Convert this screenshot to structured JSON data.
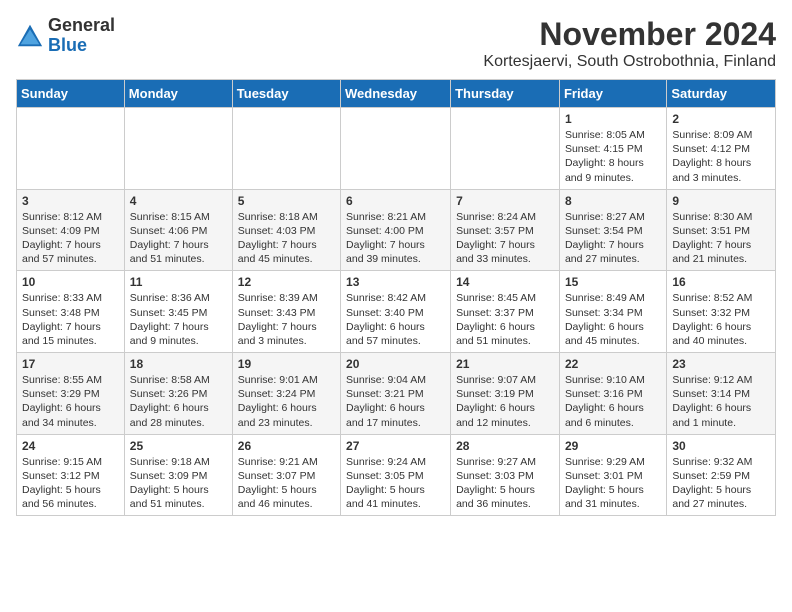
{
  "header": {
    "logo_general": "General",
    "logo_blue": "Blue",
    "month_year": "November 2024",
    "location": "Kortesjaervi, South Ostrobothnia, Finland"
  },
  "weekdays": [
    "Sunday",
    "Monday",
    "Tuesday",
    "Wednesday",
    "Thursday",
    "Friday",
    "Saturday"
  ],
  "weeks": [
    [
      {
        "day": "",
        "info": ""
      },
      {
        "day": "",
        "info": ""
      },
      {
        "day": "",
        "info": ""
      },
      {
        "day": "",
        "info": ""
      },
      {
        "day": "",
        "info": ""
      },
      {
        "day": "1",
        "info": "Sunrise: 8:05 AM\nSunset: 4:15 PM\nDaylight: 8 hours and 9 minutes."
      },
      {
        "day": "2",
        "info": "Sunrise: 8:09 AM\nSunset: 4:12 PM\nDaylight: 8 hours and 3 minutes."
      }
    ],
    [
      {
        "day": "3",
        "info": "Sunrise: 8:12 AM\nSunset: 4:09 PM\nDaylight: 7 hours and 57 minutes."
      },
      {
        "day": "4",
        "info": "Sunrise: 8:15 AM\nSunset: 4:06 PM\nDaylight: 7 hours and 51 minutes."
      },
      {
        "day": "5",
        "info": "Sunrise: 8:18 AM\nSunset: 4:03 PM\nDaylight: 7 hours and 45 minutes."
      },
      {
        "day": "6",
        "info": "Sunrise: 8:21 AM\nSunset: 4:00 PM\nDaylight: 7 hours and 39 minutes."
      },
      {
        "day": "7",
        "info": "Sunrise: 8:24 AM\nSunset: 3:57 PM\nDaylight: 7 hours and 33 minutes."
      },
      {
        "day": "8",
        "info": "Sunrise: 8:27 AM\nSunset: 3:54 PM\nDaylight: 7 hours and 27 minutes."
      },
      {
        "day": "9",
        "info": "Sunrise: 8:30 AM\nSunset: 3:51 PM\nDaylight: 7 hours and 21 minutes."
      }
    ],
    [
      {
        "day": "10",
        "info": "Sunrise: 8:33 AM\nSunset: 3:48 PM\nDaylight: 7 hours and 15 minutes."
      },
      {
        "day": "11",
        "info": "Sunrise: 8:36 AM\nSunset: 3:45 PM\nDaylight: 7 hours and 9 minutes."
      },
      {
        "day": "12",
        "info": "Sunrise: 8:39 AM\nSunset: 3:43 PM\nDaylight: 7 hours and 3 minutes."
      },
      {
        "day": "13",
        "info": "Sunrise: 8:42 AM\nSunset: 3:40 PM\nDaylight: 6 hours and 57 minutes."
      },
      {
        "day": "14",
        "info": "Sunrise: 8:45 AM\nSunset: 3:37 PM\nDaylight: 6 hours and 51 minutes."
      },
      {
        "day": "15",
        "info": "Sunrise: 8:49 AM\nSunset: 3:34 PM\nDaylight: 6 hours and 45 minutes."
      },
      {
        "day": "16",
        "info": "Sunrise: 8:52 AM\nSunset: 3:32 PM\nDaylight: 6 hours and 40 minutes."
      }
    ],
    [
      {
        "day": "17",
        "info": "Sunrise: 8:55 AM\nSunset: 3:29 PM\nDaylight: 6 hours and 34 minutes."
      },
      {
        "day": "18",
        "info": "Sunrise: 8:58 AM\nSunset: 3:26 PM\nDaylight: 6 hours and 28 minutes."
      },
      {
        "day": "19",
        "info": "Sunrise: 9:01 AM\nSunset: 3:24 PM\nDaylight: 6 hours and 23 minutes."
      },
      {
        "day": "20",
        "info": "Sunrise: 9:04 AM\nSunset: 3:21 PM\nDaylight: 6 hours and 17 minutes."
      },
      {
        "day": "21",
        "info": "Sunrise: 9:07 AM\nSunset: 3:19 PM\nDaylight: 6 hours and 12 minutes."
      },
      {
        "day": "22",
        "info": "Sunrise: 9:10 AM\nSunset: 3:16 PM\nDaylight: 6 hours and 6 minutes."
      },
      {
        "day": "23",
        "info": "Sunrise: 9:12 AM\nSunset: 3:14 PM\nDaylight: 6 hours and 1 minute."
      }
    ],
    [
      {
        "day": "24",
        "info": "Sunrise: 9:15 AM\nSunset: 3:12 PM\nDaylight: 5 hours and 56 minutes."
      },
      {
        "day": "25",
        "info": "Sunrise: 9:18 AM\nSunset: 3:09 PM\nDaylight: 5 hours and 51 minutes."
      },
      {
        "day": "26",
        "info": "Sunrise: 9:21 AM\nSunset: 3:07 PM\nDaylight: 5 hours and 46 minutes."
      },
      {
        "day": "27",
        "info": "Sunrise: 9:24 AM\nSunset: 3:05 PM\nDaylight: 5 hours and 41 minutes."
      },
      {
        "day": "28",
        "info": "Sunrise: 9:27 AM\nSunset: 3:03 PM\nDaylight: 5 hours and 36 minutes."
      },
      {
        "day": "29",
        "info": "Sunrise: 9:29 AM\nSunset: 3:01 PM\nDaylight: 5 hours and 31 minutes."
      },
      {
        "day": "30",
        "info": "Sunrise: 9:32 AM\nSunset: 2:59 PM\nDaylight: 5 hours and 27 minutes."
      }
    ]
  ]
}
